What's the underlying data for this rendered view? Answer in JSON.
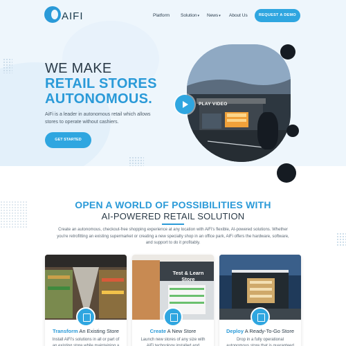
{
  "brand": {
    "logo_text": "AIFI"
  },
  "nav": {
    "items": [
      {
        "label": "Platform",
        "dropdown": false
      },
      {
        "label": "Solution",
        "dropdown": true
      },
      {
        "label": "News",
        "dropdown": true
      },
      {
        "label": "About Us",
        "dropdown": false
      }
    ],
    "demo_button": "REQUEST A DEMO"
  },
  "hero": {
    "line1": "WE MAKE",
    "line2": "RETAIL STORES",
    "line3": "AUTONOMOUS.",
    "subtitle": "AiFi is a leader in autonomous retail which allows stores to operate without cashiers.",
    "cta": "GET STARTED",
    "video_label": "PLAY VIDEO"
  },
  "section": {
    "title_line1": "OPEN A WORLD OF POSSIBILITIES WITH",
    "title_line2": "AI-POWERED RETAIL SOLUTION",
    "body": "Create an autonomous, checkout-free shopping experience at any location with AiFi's flexible, AI-powered solutions. Whether you're retrofitting an existing supermarket or creating a new specialty shop in an office park, AiFi offers the hardware, software, and support to do it profitably."
  },
  "cards": [
    {
      "title_bold": "Transform",
      "title_rest": " An Existing Store",
      "body": "Install AiFi's solutions in all or part of an existing store while maintaining a",
      "icon": "store-screen-icon"
    },
    {
      "title_bold": "Create",
      "title_rest": " A New Store",
      "body": "Launch new stores of any size with AiFi technology installed and",
      "icon": "new-store-icon",
      "sign": "Test & Learn Store"
    },
    {
      "title_bold": "Deploy",
      "title_rest": " A Ready-To-Go Store",
      "body": "Drop in a fully operational autonomous store that is guaranteed",
      "icon": "ready-store-icon"
    }
  ],
  "colors": {
    "accent": "#2fa6e0",
    "heading_blue": "#2a9ad8",
    "dark_text": "#2a3a47",
    "hero_bg": "#eef6fc"
  }
}
